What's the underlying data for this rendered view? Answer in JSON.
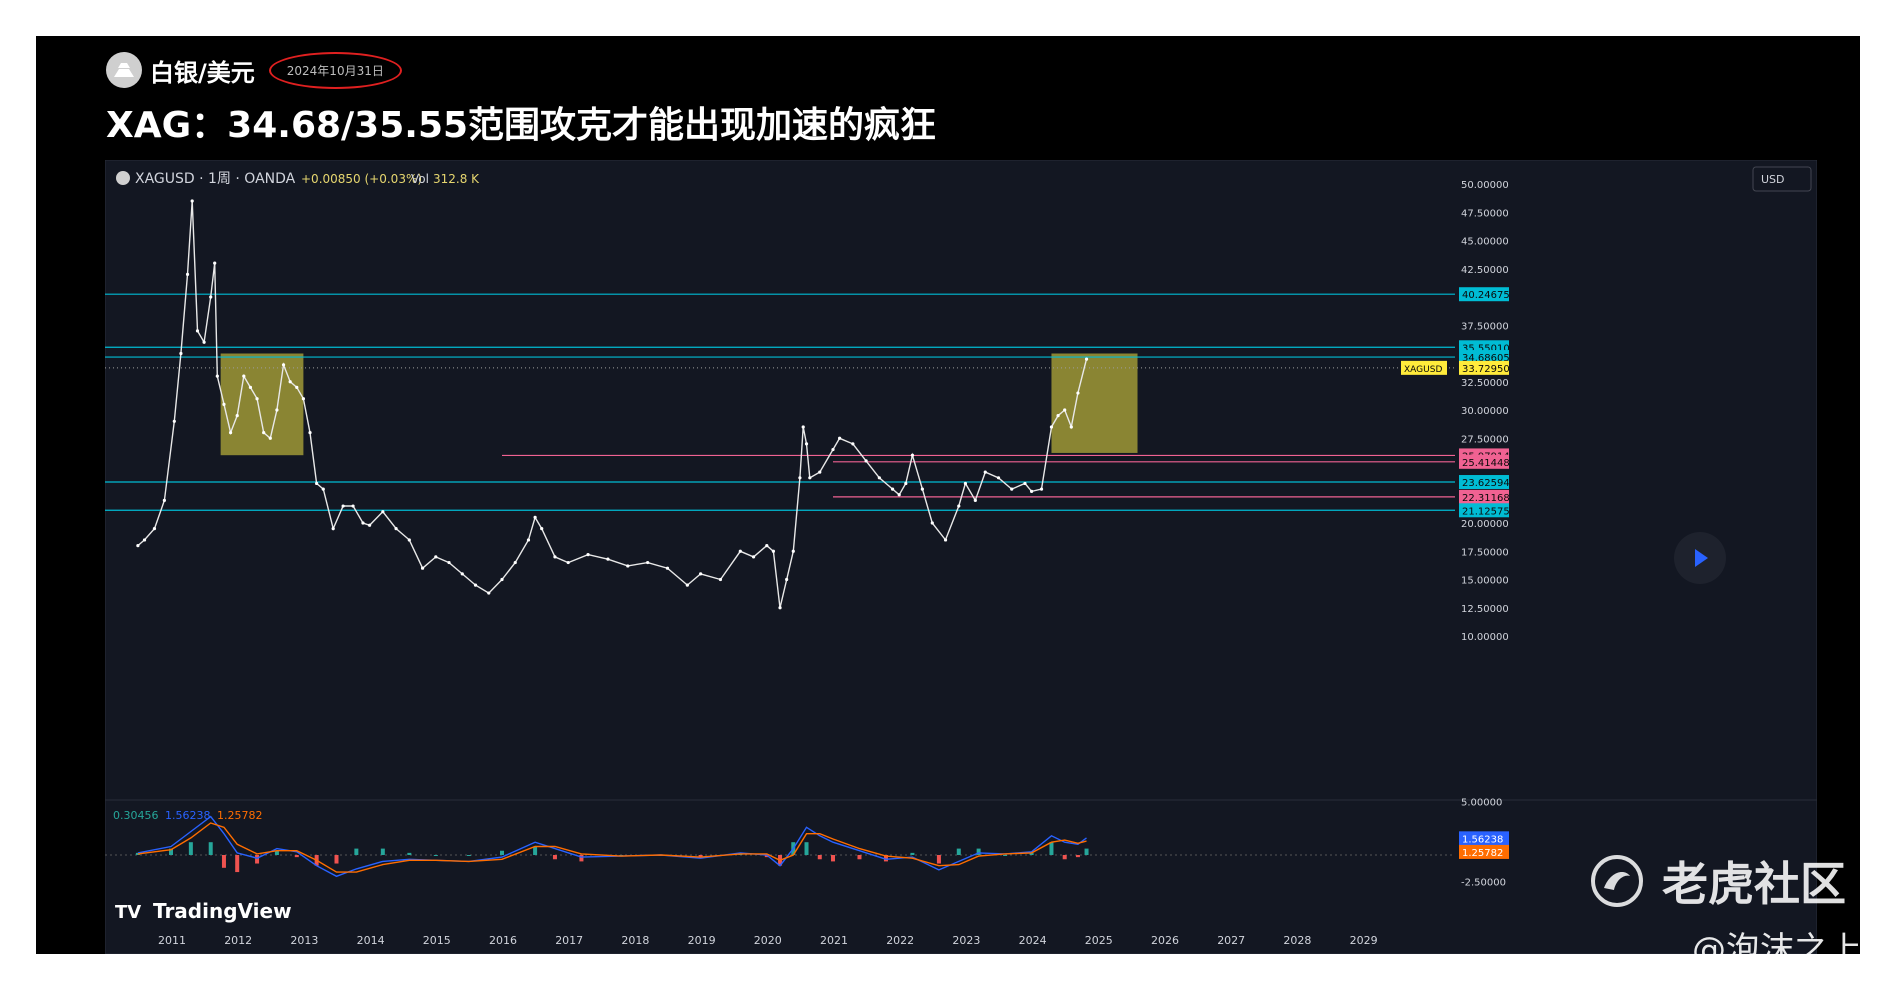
{
  "post": {
    "author": "白银/美元",
    "date": "2024年10月31日",
    "headline": "XAG：34.68/35.55范围攻克才能出现加速的疯狂"
  },
  "watermark": {
    "community": "老虎社区",
    "credit": "@泡沫之上",
    "logo_icon": "tiger-swirl-icon"
  },
  "chart_data": {
    "type": "line",
    "header": {
      "symbol": "XAGUSD · 1周 · OANDA",
      "change": "+0.00850 (+0.03%)",
      "vol_label": "Vol",
      "vol_value": "312.8 K",
      "currency": "USD"
    },
    "brand": "TradingView",
    "x_ticks": [
      "2011",
      "2012",
      "2013",
      "2014",
      "2015",
      "2016",
      "2017",
      "2018",
      "2019",
      "2020",
      "2021",
      "2022",
      "2023",
      "2024",
      "2025",
      "2026",
      "2027",
      "2028",
      "2029"
    ],
    "y_ticks": [
      "50.00000",
      "47.50000",
      "45.00000",
      "42.50000",
      "37.50000",
      "32.50000",
      "30.00000",
      "27.50000",
      "20.00000",
      "17.50000",
      "15.00000",
      "12.50000",
      "10.00000"
    ],
    "ylim": [
      10,
      50
    ],
    "series": [
      {
        "type": "line",
        "x": [
          2010.5,
          2010.6,
          2010.75,
          2010.9,
          2011.05,
          2011.15,
          2011.25,
          2011.32,
          2011.4,
          2011.5,
          2011.6,
          2011.66,
          2011.7,
          2011.8,
          2011.9,
          2012.0,
          2012.1,
          2012.2,
          2012.3,
          2012.4,
          2012.5,
          2012.6,
          2012.7,
          2012.8,
          2012.9,
          2013.0,
          2013.1,
          2013.2,
          2013.3,
          2013.45,
          2013.6,
          2013.75,
          2013.9,
          2014.0,
          2014.2,
          2014.4,
          2014.6,
          2014.8,
          2015.0,
          2015.2,
          2015.4,
          2015.6,
          2015.8,
          2016.0,
          2016.2,
          2016.4,
          2016.5,
          2016.6,
          2016.8,
          2017.0,
          2017.3,
          2017.6,
          2017.9,
          2018.2,
          2018.5,
          2018.8,
          2019.0,
          2019.3,
          2019.6,
          2019.8,
          2020.0,
          2020.1,
          2020.2,
          2020.3,
          2020.4,
          2020.5,
          2020.55,
          2020.6,
          2020.65,
          2020.8,
          2021.0,
          2021.1,
          2021.3,
          2021.5,
          2021.7,
          2021.9,
          2022.0,
          2022.1,
          2022.2,
          2022.35,
          2022.5,
          2022.7,
          2022.9,
          2023.0,
          2023.15,
          2023.3,
          2023.5,
          2023.7,
          2023.9,
          2024.0,
          2024.15,
          2024.3,
          2024.4,
          2024.5,
          2024.6,
          2024.7,
          2024.83
        ],
        "y": [
          18.0,
          18.5,
          19.5,
          22.0,
          29.0,
          35.0,
          42.0,
          48.5,
          37.0,
          36.0,
          40.0,
          43.0,
          33.0,
          30.5,
          28.0,
          29.5,
          33.0,
          32.0,
          31.0,
          28.0,
          27.5,
          30.0,
          34.0,
          32.5,
          32.0,
          31.0,
          28.0,
          23.5,
          23.0,
          19.5,
          21.5,
          21.5,
          20.0,
          19.8,
          21.0,
          19.5,
          18.5,
          16.0,
          17.0,
          16.5,
          15.5,
          14.5,
          13.8,
          15.0,
          16.5,
          18.5,
          20.5,
          19.5,
          17.0,
          16.5,
          17.2,
          16.8,
          16.2,
          16.5,
          16.0,
          14.5,
          15.5,
          15.0,
          17.5,
          17.0,
          18.0,
          17.5,
          12.5,
          15.0,
          17.5,
          24.0,
          28.5,
          27.0,
          24.0,
          24.5,
          26.5,
          27.5,
          27.0,
          25.5,
          24.0,
          23.0,
          22.5,
          23.5,
          26.0,
          23.0,
          20.0,
          18.5,
          21.5,
          23.5,
          22.0,
          24.5,
          24.0,
          23.0,
          23.5,
          22.8,
          23.0,
          28.5,
          29.5,
          30.0,
          28.5,
          31.5,
          34.5
        ]
      }
    ],
    "levels": [
      {
        "value": 40.24675,
        "label": "40.24675",
        "color": "#00bcd4"
      },
      {
        "value": 35.5501,
        "label": "35.55010",
        "color": "#00bcd4"
      },
      {
        "value": 34.68605,
        "label": "34.68605",
        "color": "#00bcd4"
      },
      {
        "value": 25.97914,
        "label": "25.97914",
        "color": "#f06292"
      },
      {
        "value": 25.41448,
        "label": "25.41448",
        "color": "#f06292"
      },
      {
        "value": 23.62594,
        "label": "23.62594",
        "color": "#00bcd4"
      },
      {
        "value": 22.31168,
        "label": "22.31168",
        "color": "#f06292"
      },
      {
        "value": 21.12575,
        "label": "21.12575",
        "color": "#00bcd4"
      }
    ],
    "current_price": {
      "name": "XAGUSD",
      "value": 33.7295,
      "label": "33.72950",
      "color": "#ffeb3b"
    },
    "zones": [
      {
        "x": [
          2011.75,
          2013.0
        ],
        "y": [
          26.0,
          35.0
        ],
        "color": "#b8b03a"
      },
      {
        "x": [
          2024.3,
          2025.6
        ],
        "y": [
          26.2,
          35.0
        ],
        "color": "#b8b03a"
      }
    ],
    "indicator": {
      "values": [
        "0.30456",
        "1.56238",
        "1.25782"
      ],
      "value_colors": [
        "#26a69a",
        "#2962ff",
        "#ff6d00"
      ],
      "y_ticks": [
        "5.00000",
        "-2.50000"
      ],
      "badges": [
        {
          "label": "1.56238",
          "color": "#2962ff"
        },
        {
          "label": "1.25782",
          "color": "#ff6d00"
        }
      ],
      "macd": {
        "x": [
          2010.5,
          2011.0,
          2011.3,
          2011.6,
          2011.8,
          2012.0,
          2012.3,
          2012.6,
          2012.9,
          2013.2,
          2013.5,
          2013.8,
          2014.2,
          2014.6,
          2015.0,
          2015.5,
          2016.0,
          2016.5,
          2016.8,
          2017.2,
          2017.8,
          2018.4,
          2019.0,
          2019.6,
          2020.0,
          2020.2,
          2020.4,
          2020.6,
          2020.8,
          2021.0,
          2021.4,
          2021.8,
          2022.2,
          2022.6,
          2022.9,
          2023.2,
          2023.6,
          2024.0,
          2024.3,
          2024.5,
          2024.7,
          2024.83
        ],
        "y": [
          0.2,
          0.8,
          2.2,
          3.6,
          2.0,
          0.2,
          -0.3,
          0.6,
          0.3,
          -1.0,
          -2.0,
          -1.3,
          -0.6,
          -0.4,
          -0.5,
          -0.6,
          -0.2,
          1.2,
          0.6,
          -0.2,
          -0.1,
          0.0,
          -0.3,
          0.2,
          0.0,
          -1.0,
          0.6,
          2.6,
          1.8,
          1.2,
          0.4,
          -0.4,
          -0.2,
          -1.4,
          -0.6,
          0.2,
          0.1,
          0.3,
          1.8,
          1.2,
          1.0,
          1.6
        ]
      },
      "signal": {
        "x": [
          2010.5,
          2011.0,
          2011.3,
          2011.6,
          2011.8,
          2012.0,
          2012.3,
          2012.6,
          2012.9,
          2013.2,
          2013.5,
          2013.8,
          2014.2,
          2014.6,
          2015.0,
          2015.5,
          2016.0,
          2016.5,
          2016.8,
          2017.2,
          2017.8,
          2018.4,
          2019.0,
          2019.6,
          2020.0,
          2020.2,
          2020.4,
          2020.6,
          2020.8,
          2021.0,
          2021.4,
          2021.8,
          2022.2,
          2022.6,
          2022.9,
          2023.2,
          2023.6,
          2024.0,
          2024.3,
          2024.5,
          2024.7,
          2024.83
        ],
        "y": [
          0.1,
          0.5,
          1.6,
          3.0,
          2.6,
          1.0,
          0.1,
          0.4,
          0.4,
          -0.5,
          -1.6,
          -1.6,
          -0.9,
          -0.5,
          -0.5,
          -0.6,
          -0.4,
          0.8,
          0.8,
          0.1,
          -0.1,
          0.0,
          -0.2,
          0.1,
          0.1,
          -0.5,
          0.0,
          2.0,
          2.0,
          1.5,
          0.6,
          -0.1,
          -0.3,
          -1.0,
          -0.9,
          -0.1,
          0.1,
          0.2,
          1.2,
          1.4,
          1.1,
          1.3
        ]
      }
    }
  }
}
